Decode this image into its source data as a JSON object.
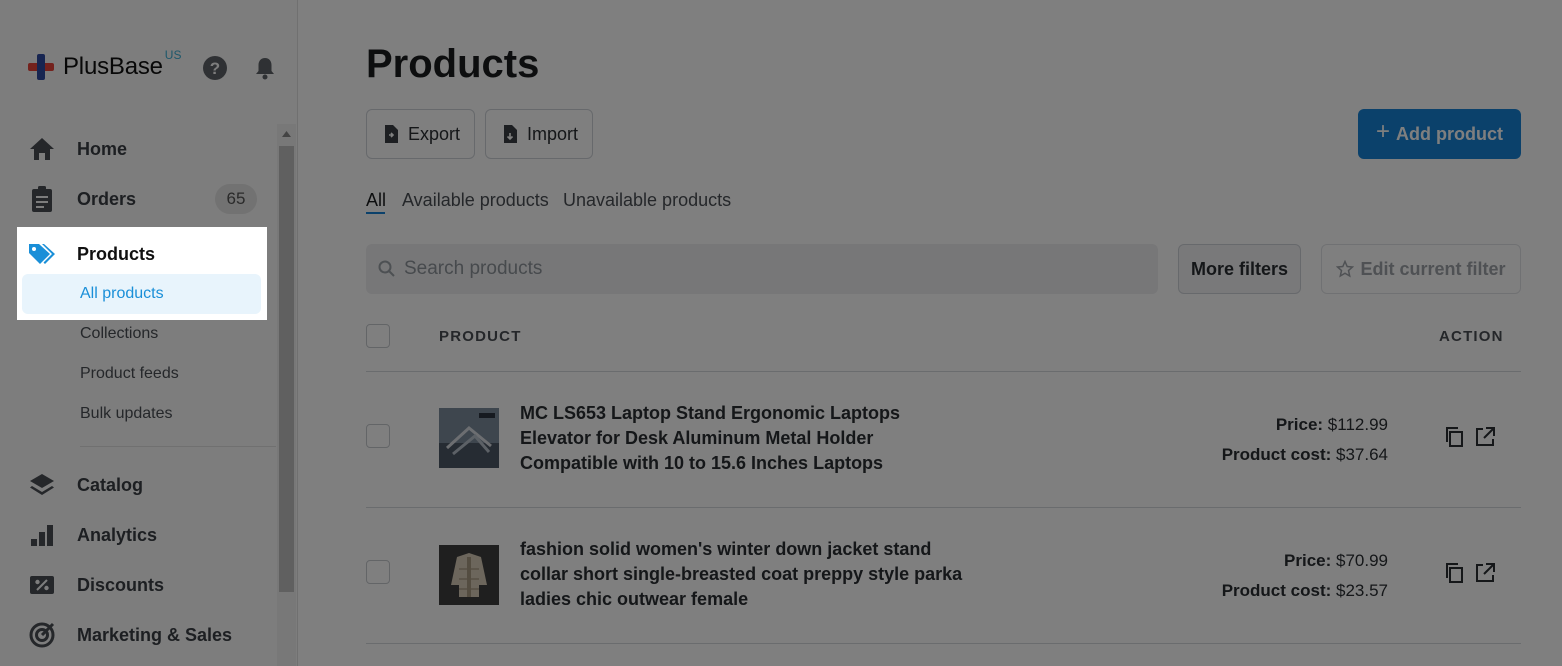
{
  "brand": {
    "name": "PlusBase",
    "region": "US"
  },
  "sidebar": {
    "items": [
      {
        "label": "Home",
        "icon": "home-icon"
      },
      {
        "label": "Orders",
        "icon": "clipboard-icon",
        "badge": "65"
      },
      {
        "label": "Products",
        "icon": "tag-icon"
      },
      {
        "label": "Catalog",
        "icon": "layers-icon"
      },
      {
        "label": "Analytics",
        "icon": "bar-chart-icon"
      },
      {
        "label": "Discounts",
        "icon": "discount-icon"
      },
      {
        "label": "Marketing & Sales",
        "icon": "target-icon"
      }
    ],
    "product_sub": [
      "All products",
      "Collections",
      "Product feeds",
      "Bulk updates"
    ]
  },
  "main": {
    "title": "Products",
    "export_label": "Export",
    "import_label": "Import",
    "add_label": "Add product",
    "tabs": [
      "All",
      "Available products",
      "Unavailable products"
    ],
    "search_placeholder": "Search products",
    "more_filters": "More filters",
    "edit_filter": "Edit current filter",
    "col_product": "PRODUCT",
    "col_action": "ACTION",
    "price_label": "Price:",
    "cost_label": "Product cost:",
    "products": [
      {
        "title_lines": [
          "MC LS653 Laptop Stand Ergonomic Laptops",
          "Elevator for Desk Aluminum Metal Holder",
          "Compatible with 10 to 15.6 Inches Laptops"
        ],
        "price": "$112.99",
        "cost": "$37.64"
      },
      {
        "title_lines": [
          "fashion solid women's winter down jacket stand",
          "collar short single-breasted coat preppy style parka",
          "ladies chic outwear female"
        ],
        "price": "$70.99",
        "cost": "$23.57"
      }
    ]
  },
  "colors": {
    "accent": "#1683d6",
    "overlay": "rgba(0,0,0,0.5)",
    "selected_bg": "#e8f4fc"
  }
}
